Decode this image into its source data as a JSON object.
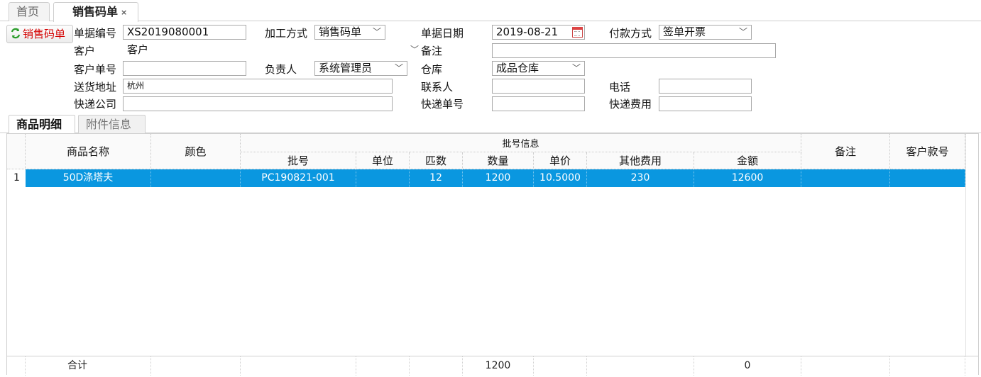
{
  "tabs": {
    "home": "首页",
    "active": "销售码单",
    "close": "×"
  },
  "side_button": {
    "label": "销售码单"
  },
  "form": {
    "doc_no": {
      "label": "单据编号",
      "value": "XS2019080001"
    },
    "process": {
      "label": "加工方式",
      "value": "销售码单"
    },
    "doc_date": {
      "label": "单据日期",
      "value": "2019-08-21"
    },
    "payment": {
      "label": "付款方式",
      "value": "签单开票"
    },
    "customer": {
      "label": "客户",
      "value": "客户"
    },
    "remark": {
      "label": "备注",
      "value": ""
    },
    "customer_order": {
      "label": "客户单号",
      "value": ""
    },
    "owner": {
      "label": "负责人",
      "value": "系统管理员"
    },
    "warehouse": {
      "label": "仓库",
      "value": "成品仓库"
    },
    "address": {
      "label": "送货地址",
      "value": "杭州"
    },
    "contact": {
      "label": "联系人",
      "value": ""
    },
    "phone": {
      "label": "电话",
      "value": ""
    },
    "courier": {
      "label": "快递公司",
      "value": ""
    },
    "tracking": {
      "label": "快递单号",
      "value": ""
    },
    "express_fee": {
      "label": "快递费用",
      "value": ""
    }
  },
  "subtabs": {
    "detail": "商品明细",
    "attach": "附件信息"
  },
  "grid": {
    "headers": {
      "name": "商品名称",
      "color": "颜色",
      "batch_group": "批号信息",
      "batch": "批号",
      "unit": "单位",
      "pieces": "匹数",
      "qty": "数量",
      "price": "单价",
      "other_fee": "其他费用",
      "amount": "金额",
      "remark": "备注",
      "cust_style": "客户款号"
    },
    "rows": [
      {
        "num": "1",
        "name": "50D涤塔夫",
        "color": "",
        "batch": "PC190821-001",
        "unit": "",
        "pieces": "12",
        "qty": "1200",
        "price": "10.5000",
        "other_fee": "230",
        "amount": "12600",
        "remark": "",
        "cust_style": ""
      }
    ],
    "footer": {
      "label": "合计",
      "qty": "1200",
      "amount": "0"
    }
  },
  "colors": {
    "selected_row": "#0a97e0",
    "side_button_text": "#d40000"
  }
}
